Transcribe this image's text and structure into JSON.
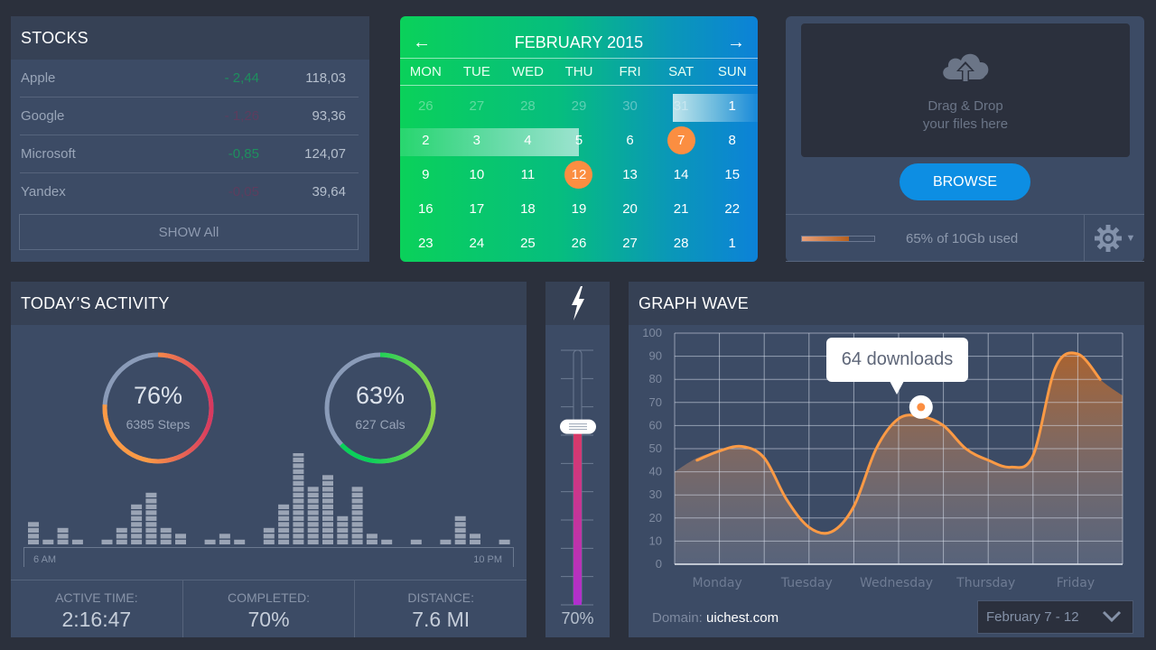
{
  "stocks": {
    "title": "STOCKS",
    "rows": [
      {
        "name": "Apple",
        "change": "- 2,44",
        "price": "118,03",
        "trend": "up"
      },
      {
        "name": "Google",
        "change": "- 1,26",
        "price": "93,36",
        "trend": "down"
      },
      {
        "name": "Microsoft",
        "change": "-0,85",
        "price": "124,07",
        "trend": "up"
      },
      {
        "name": "Yandex",
        "change": "-0,05",
        "price": "39,64",
        "trend": "down"
      }
    ],
    "show_all_label": "SHOW All",
    "colors": {
      "up": "#1e8f5e",
      "down": "#5d3d5e"
    }
  },
  "calendar": {
    "title": "FEBRUARY 2015",
    "prev_icon": "arrow-left-icon",
    "next_icon": "arrow-right-icon",
    "weekdays": [
      "MON",
      "TUE",
      "WED",
      "THU",
      "FRI",
      "SAT",
      "SUN"
    ],
    "weeks": [
      [
        {
          "d": "26",
          "m": true
        },
        {
          "d": "27",
          "m": true
        },
        {
          "d": "28",
          "m": true
        },
        {
          "d": "29",
          "m": true
        },
        {
          "d": "30",
          "m": true
        },
        {
          "d": "31",
          "m": true
        },
        {
          "d": "1"
        }
      ],
      [
        {
          "d": "2"
        },
        {
          "d": "3"
        },
        {
          "d": "4"
        },
        {
          "d": "5"
        },
        {
          "d": "6"
        },
        {
          "d": "7",
          "sel": true
        },
        {
          "d": "8"
        }
      ],
      [
        {
          "d": "9"
        },
        {
          "d": "10"
        },
        {
          "d": "11"
        },
        {
          "d": "12",
          "sel": true
        },
        {
          "d": "13"
        },
        {
          "d": "14"
        },
        {
          "d": "15"
        }
      ],
      [
        {
          "d": "16"
        },
        {
          "d": "17"
        },
        {
          "d": "18"
        },
        {
          "d": "19"
        },
        {
          "d": "20"
        },
        {
          "d": "21"
        },
        {
          "d": "22"
        }
      ],
      [
        {
          "d": "23"
        },
        {
          "d": "24"
        },
        {
          "d": "25"
        },
        {
          "d": "26"
        },
        {
          "d": "27"
        },
        {
          "d": "28"
        },
        {
          "d": "1"
        }
      ]
    ],
    "range_start": "7",
    "range_end": "12",
    "accent": "#fb8e41"
  },
  "upload": {
    "icon": "cloud-upload-icon",
    "drop_line1": "Drag & Drop",
    "drop_line2": "your files here",
    "browse_label": "BROWSE",
    "usage_percent": 65,
    "usage_text": "65% of 10Gb used",
    "settings_icon": "gear-icon"
  },
  "activity": {
    "title": "TODAY’S ACTIVITY",
    "rings": [
      {
        "value": "76%",
        "percent": 76,
        "sub": "6385 Steps",
        "colors": [
          "#d8395f",
          "#fb9a45"
        ]
      },
      {
        "value": "63%",
        "percent": 63,
        "sub": "627 Cals",
        "colors": [
          "#8fd24a",
          "#0ad15a"
        ]
      }
    ],
    "bars": [
      4,
      1,
      3,
      1,
      0,
      1,
      3,
      7,
      9,
      3,
      2,
      0,
      1,
      2,
      1,
      0,
      3,
      7,
      16,
      10,
      12,
      5,
      10,
      2,
      1,
      0,
      1,
      0,
      1,
      5,
      2,
      0,
      1
    ],
    "axis_start": "6 AM",
    "axis_end": "10 PM",
    "stats": [
      {
        "label": "ACTIVE TIME:",
        "value": "2:16:47"
      },
      {
        "label": "COMPLETED:",
        "value": "70%"
      },
      {
        "label": "DISTANCE:",
        "value": "7.6 MI"
      }
    ]
  },
  "slider": {
    "icon": "lightning-icon",
    "percent": 70,
    "label": "70%"
  },
  "graph": {
    "title": "GRAPH WAVE",
    "tooltip": "64 downloads",
    "domain_label": "Domain:",
    "domain_value": "uichest.com",
    "date_range": "February 7 - 12",
    "chart_data": {
      "type": "area",
      "title": "GRAPH WAVE",
      "x_labels": [
        "Monday",
        "Tuesday",
        "Wednesday",
        "Thursday",
        "Friday"
      ],
      "x": [
        0,
        0.5,
        1,
        1.5,
        2,
        2.5,
        3,
        3.5,
        4,
        4.5,
        5,
        5.5,
        6,
        6.5,
        7,
        7.5,
        8,
        8.5,
        9,
        9.5,
        10
      ],
      "series": [
        {
          "name": "line",
          "values": [
            null,
            45,
            49,
            51,
            46,
            28,
            16,
            14,
            25,
            50,
            63,
            64,
            60,
            50,
            45,
            42,
            47,
            85,
            91,
            80,
            null
          ]
        },
        {
          "name": "area",
          "values": [
            40,
            46,
            49,
            51,
            46,
            28,
            16,
            14,
            25,
            50,
            63,
            64,
            60,
            50,
            45,
            42,
            47,
            85,
            91,
            80,
            73
          ]
        }
      ],
      "highlight": {
        "x": 5.5,
        "value": 64,
        "label": "64 downloads"
      },
      "ylim": [
        0,
        100
      ],
      "yticks": [
        0,
        10,
        20,
        30,
        40,
        50,
        60,
        70,
        80,
        90,
        100
      ],
      "grid": true
    }
  }
}
